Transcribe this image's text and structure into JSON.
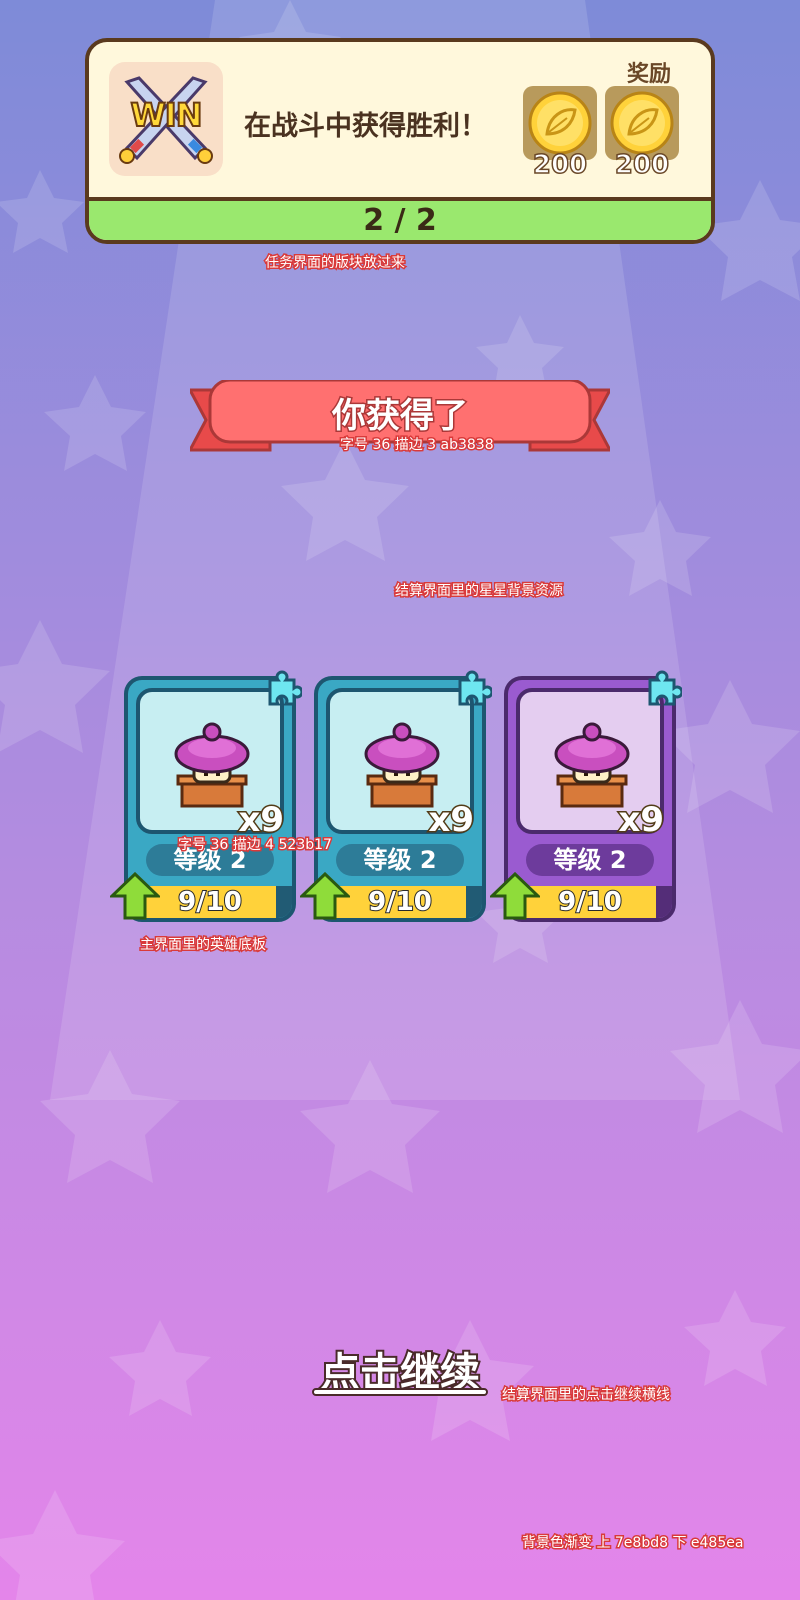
{
  "quest": {
    "icon_text": "WIN",
    "description": "在战斗中获得胜利！",
    "reward_label": "奖励",
    "rewards": [
      {
        "icon": "leaf-coin-icon",
        "amount": "200"
      },
      {
        "icon": "leaf-coin-icon",
        "amount": "200"
      }
    ],
    "progress": "2 / 2",
    "note": "任务界面的版块放过来"
  },
  "ribbon": {
    "title": "你获得了",
    "note": "字号 36 描边 3 ab3838"
  },
  "star_bg_note": "结算界面里的星星背景资源",
  "cards": [
    {
      "theme": "teal",
      "count": "x9",
      "level": "等级 2",
      "progress": "9/10",
      "progress_value": 0.9
    },
    {
      "theme": "teal",
      "count": "x9",
      "level": "等级 2",
      "progress": "9/10",
      "progress_value": 0.9
    },
    {
      "theme": "purple",
      "count": "x9",
      "level": "等级 2",
      "progress": "9/10",
      "progress_value": 0.9
    }
  ],
  "card_count_note": "字号 36 描边 4 523b17",
  "card_base_note": "主界面里的英雄底板",
  "continue": {
    "label": "点击继续",
    "note": "结算界面里的点击继续横线"
  },
  "bg_note": "背景色渐变 上 7e8bd8 下 e485ea",
  "colors": {
    "bg_top": "#7e8bd8",
    "bg_bottom": "#e485ea",
    "ribbon_stroke": "#ab3838",
    "count_stroke": "#523b17"
  }
}
